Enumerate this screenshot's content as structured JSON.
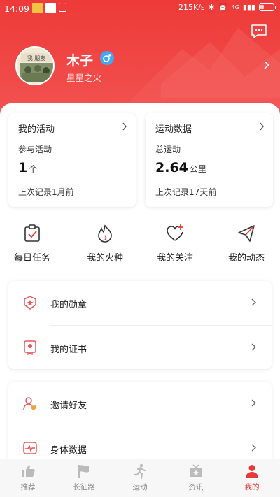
{
  "status_bar": {
    "time": "14:09",
    "network_speed": "215K/s",
    "network_type": "4G"
  },
  "profile": {
    "name": "木子",
    "subtitle": "星星之火",
    "avatar_text": "我 朋友"
  },
  "activity_card": {
    "title": "我的活动",
    "label": "参与活动",
    "value": "1",
    "unit": "个",
    "footer": "上次记录1月前"
  },
  "sports_card": {
    "title": "运动数据",
    "label": "总运动",
    "value": "2.64",
    "unit": "公里",
    "footer": "上次记录17天前"
  },
  "quick_actions": [
    {
      "label": "每日任务",
      "icon": "clipboard-check-icon"
    },
    {
      "label": "我的火种",
      "icon": "flame-icon"
    },
    {
      "label": "我的关注",
      "icon": "heart-plus-icon"
    },
    {
      "label": "我的动态",
      "icon": "paper-plane-icon"
    }
  ],
  "menu_group_1": [
    {
      "label": "我的勋章",
      "icon": "medal-icon"
    },
    {
      "label": "我的证书",
      "icon": "certificate-icon"
    }
  ],
  "menu_group_2": [
    {
      "label": "邀请好友",
      "icon": "invite-user-icon"
    },
    {
      "label": "身体数据",
      "icon": "heart-rate-icon"
    }
  ],
  "tabs": [
    {
      "label": "推荐",
      "icon": "thumbs-up-icon",
      "active": false
    },
    {
      "label": "长征路",
      "icon": "flag-icon",
      "active": false
    },
    {
      "label": "运动",
      "icon": "running-icon",
      "active": false
    },
    {
      "label": "资讯",
      "icon": "tv-icon",
      "active": false
    },
    {
      "label": "我的",
      "icon": "person-icon",
      "active": true
    }
  ],
  "colors": {
    "brand_red": "#ee3a38",
    "tab_inactive": "#bbbbbb",
    "gender_blue": "#3fa9f5"
  }
}
